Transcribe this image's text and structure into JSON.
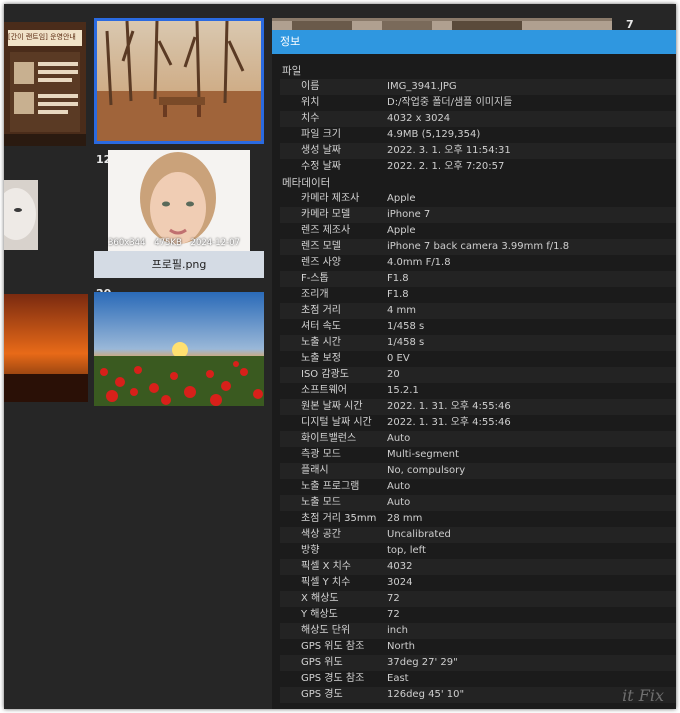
{
  "gallery": {
    "badge_12": "12",
    "badge_20": "20",
    "badge_7": "7",
    "poster_title": "[간이 랜트임] 운영안내",
    "hover_overlay": {
      "dimensions": "360x344",
      "size": "475KB",
      "date": "2024-12-07",
      "filename": "프로필.png"
    }
  },
  "panel": {
    "title": "정보",
    "sections": [
      {
        "name": "파일",
        "rows": [
          {
            "key": "이름",
            "value": "IMG_3941.JPG"
          },
          {
            "key": "위치",
            "value": "D:/작업중 폴더/샘플 이미지들"
          },
          {
            "key": "치수",
            "value": "4032 x 3024"
          },
          {
            "key": "파일 크기",
            "value": "4.9MB (5,129,354)"
          },
          {
            "key": "생성 날짜",
            "value": "2022. 3. 1. 오후 11:54:31"
          },
          {
            "key": "수정 날짜",
            "value": "2022. 2. 1. 오후 7:20:57"
          }
        ]
      },
      {
        "name": "메타데이터",
        "rows": [
          {
            "key": "카메라 제조사",
            "value": "Apple"
          },
          {
            "key": "카메라 모델",
            "value": "iPhone 7"
          },
          {
            "key": "렌즈 제조사",
            "value": "Apple"
          },
          {
            "key": "렌즈 모델",
            "value": "iPhone 7 back camera 3.99mm f/1.8"
          },
          {
            "key": "렌즈 사양",
            "value": "4.0mm F/1.8"
          },
          {
            "key": "F-스톱",
            "value": "F1.8"
          },
          {
            "key": "조리개",
            "value": "F1.8"
          },
          {
            "key": "초점 거리",
            "value": "4 mm"
          },
          {
            "key": "셔터 속도",
            "value": "1/458 s"
          },
          {
            "key": "노출 시간",
            "value": "1/458 s"
          },
          {
            "key": "노출 보정",
            "value": "0 EV"
          },
          {
            "key": "ISO 감광도",
            "value": "20"
          },
          {
            "key": "소프트웨어",
            "value": "15.2.1"
          },
          {
            "key": "원본 날짜 시간",
            "value": "2022. 1. 31. 오후 4:55:46"
          },
          {
            "key": "디지털 날짜 시간",
            "value": "2022. 1. 31. 오후 4:55:46"
          },
          {
            "key": "화이트밸런스",
            "value": "Auto"
          },
          {
            "key": "측광 모드",
            "value": "Multi-segment"
          },
          {
            "key": "플래시",
            "value": "No, compulsory"
          },
          {
            "key": "노출 프로그램",
            "value": "Auto"
          },
          {
            "key": "노출 모드",
            "value": "Auto"
          },
          {
            "key": "초점 거리 35mm",
            "value": "28 mm"
          },
          {
            "key": "색상 공간",
            "value": "Uncalibrated"
          },
          {
            "key": "방향",
            "value": "top, left"
          },
          {
            "key": "픽셀 X 치수",
            "value": "4032"
          },
          {
            "key": "픽셀 Y 치수",
            "value": "3024"
          },
          {
            "key": "X 해상도",
            "value": "72"
          },
          {
            "key": "Y 해상도",
            "value": "72"
          },
          {
            "key": "해상도 단위",
            "value": "inch"
          },
          {
            "key": "GPS 위도 참조",
            "value": "North"
          },
          {
            "key": "GPS 위도",
            "value": "37deg 27' 29\""
          },
          {
            "key": "GPS 경도 참조",
            "value": "East"
          },
          {
            "key": "GPS 경도",
            "value": "126deg 45' 10\""
          }
        ]
      }
    ]
  },
  "watermark": "it Fix",
  "colors": {
    "accent": "#2f97e0",
    "selection_border": "#2a6ae0",
    "background": "#262626"
  }
}
